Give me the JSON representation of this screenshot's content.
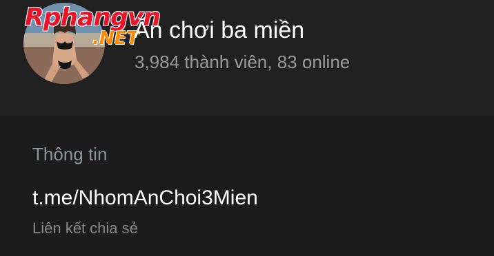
{
  "chat": {
    "title": "Ăn chơi ba miền",
    "subtitle": "3,984 thành viên, 83 online",
    "avatar_icon": "group-avatar-photo",
    "watermark": {
      "main": "Rphangvn",
      "sub": ".NET"
    }
  },
  "info": {
    "heading": "Thông tin",
    "link": "t.me/NhomAnChoi3Mien",
    "link_caption": "Liên kết chia sẻ"
  },
  "colors": {
    "background": "#1f1f1f",
    "header_background": "#212121",
    "title_text": "#ffffff",
    "secondary_text": "#9a9a9a",
    "heading_text": "#8b939b",
    "watermark_red": "#e8142a",
    "watermark_orange": "#ff8a00"
  }
}
